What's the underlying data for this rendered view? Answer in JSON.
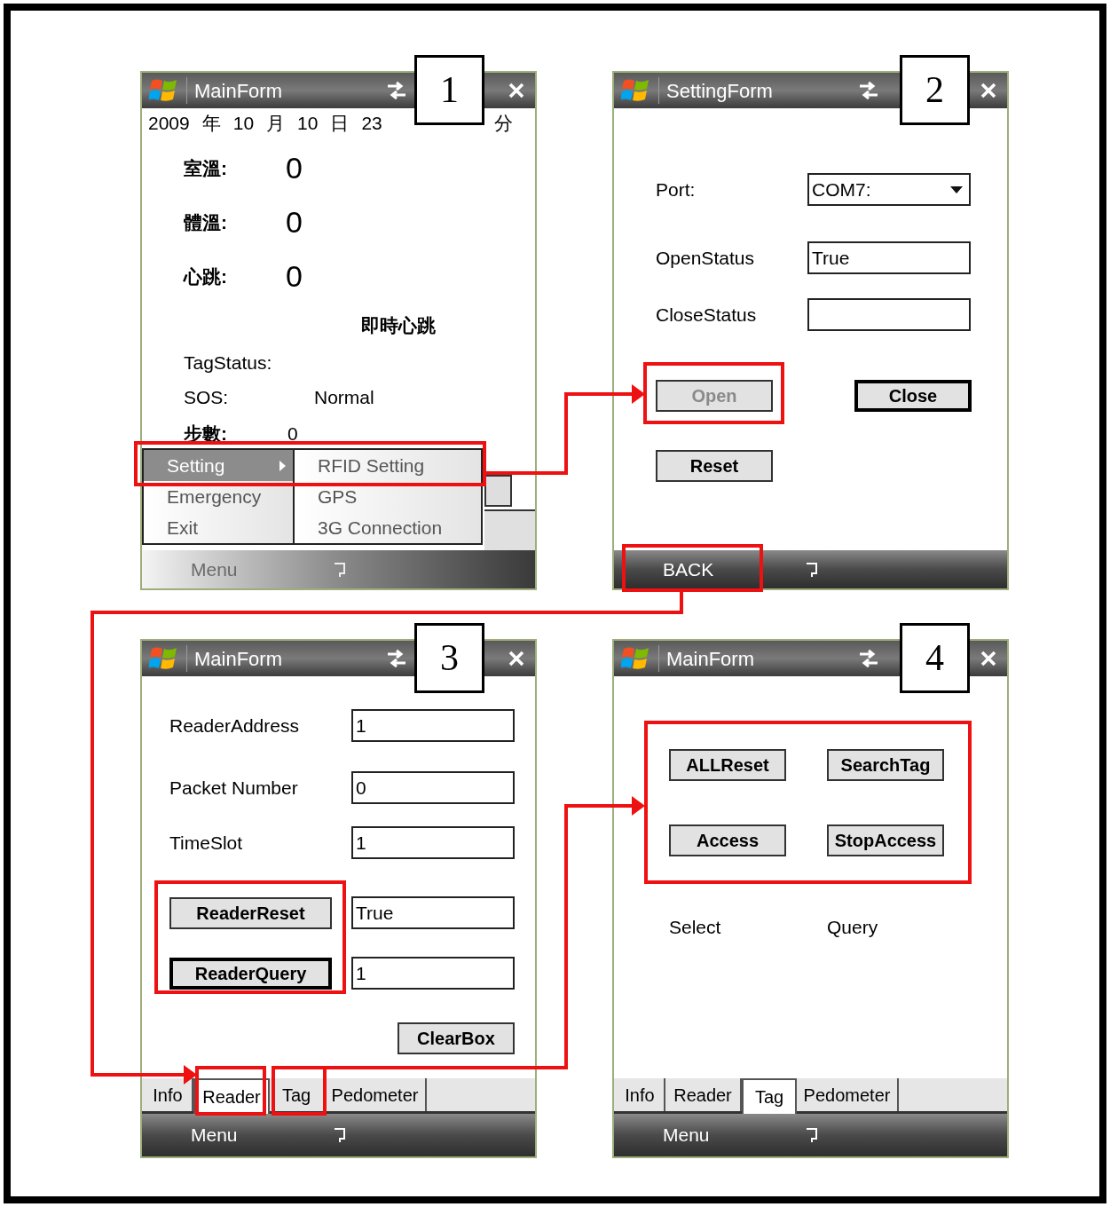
{
  "panels": [
    {
      "kind": "main",
      "number": "1",
      "title": "MainForm",
      "date": [
        "2009",
        "年",
        "10",
        "月",
        "10",
        "日",
        "23"
      ],
      "date_end": "分",
      "readings": [
        {
          "label": "室溫:",
          "value": "0"
        },
        {
          "label": "體溫:",
          "value": "0"
        },
        {
          "label": "心跳:",
          "value": "0"
        }
      ],
      "live_heart_rate": "即時心跳",
      "tag_status": "TagStatus:",
      "sos": {
        "label": "SOS:",
        "value": "Normal"
      },
      "steps": {
        "label": "步數:",
        "value": "0"
      },
      "menu": {
        "items": [
          {
            "label": "Setting",
            "selected": true,
            "has_submenu": true
          },
          {
            "label": "Emergency",
            "selected": false,
            "has_submenu": false
          },
          {
            "label": "Exit",
            "selected": false,
            "has_submenu": false
          }
        ],
        "submenu": [
          "RFID Setting",
          "GPS",
          "3G Connection"
        ]
      },
      "softkey": "Menu"
    },
    {
      "kind": "settings",
      "number": "2",
      "title": "SettingForm",
      "fields": [
        {
          "label": "Port:",
          "kind": "dropdown",
          "value": "COM7:"
        },
        {
          "label": "OpenStatus",
          "kind": "text",
          "value": "True"
        },
        {
          "label": "CloseStatus",
          "kind": "text"
        }
      ],
      "buttons": [
        {
          "label": "Open",
          "disabled": true,
          "focused": false
        },
        {
          "label": "Close",
          "disabled": false,
          "focused": true
        },
        {
          "label": "Reset",
          "disabled": false,
          "focused": false
        }
      ],
      "softkey": "BACK"
    },
    {
      "kind": "reader",
      "number": "3",
      "title": "MainForm",
      "fields": [
        {
          "label": "ReaderAddress",
          "value": "1"
        },
        {
          "label": "Packet Number",
          "value": "0"
        },
        {
          "label": "TimeSlot",
          "value": "1"
        }
      ],
      "actions": [
        {
          "label": "ReaderReset",
          "focused": false,
          "value": "True"
        },
        {
          "label": "ReaderQuery",
          "focused": true,
          "value": "1"
        }
      ],
      "clear_button": "ClearBox",
      "tabs": [
        {
          "label": "Info",
          "selected": false
        },
        {
          "label": "Reader",
          "selected": true
        },
        {
          "label": "Tag",
          "selected": false
        },
        {
          "label": "Pedometer",
          "selected": false
        }
      ],
      "softkey": "Menu"
    },
    {
      "kind": "tag",
      "number": "4",
      "title": "MainForm",
      "buttons": [
        {
          "label": "ALLReset"
        },
        {
          "label": "SearchTag"
        },
        {
          "label": "Access"
        },
        {
          "label": "StopAccess"
        }
      ],
      "labels": [
        "Select",
        "Query"
      ],
      "tabs": [
        {
          "label": "Info",
          "selected": false
        },
        {
          "label": "Reader",
          "selected": false
        },
        {
          "label": "Tag",
          "selected": true
        },
        {
          "label": "Pedometer",
          "selected": false
        }
      ],
      "softkey": "Menu"
    }
  ]
}
